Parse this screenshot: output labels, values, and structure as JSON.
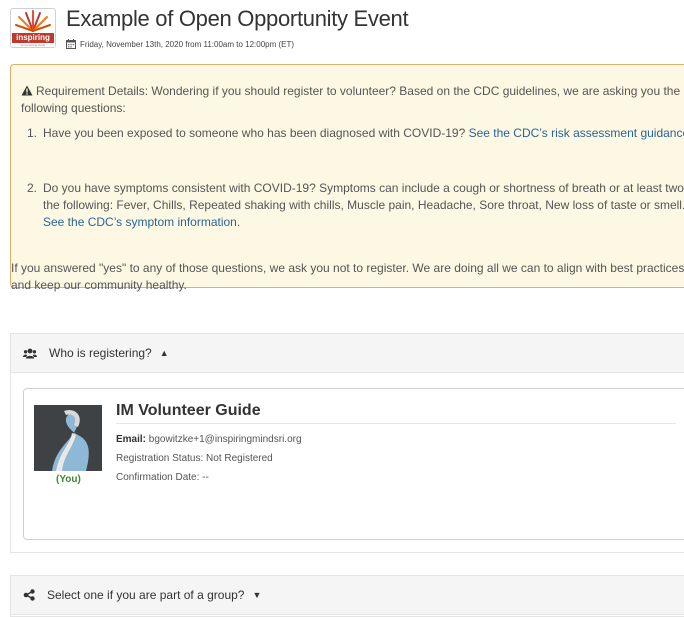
{
  "header": {
    "logo_text": "inspiring",
    "logo_subtext": "empowering study",
    "title": "Example of Open Opportunity Event",
    "date": "Friday, November 13th, 2020 from 11:00am to 12:00pm (ET)"
  },
  "requirements": {
    "intro": "Requirement Details: Wondering if you should register to volunteer? Based on the CDC guidelines, we are asking you the following questions:",
    "items": [
      {
        "number": "1.",
        "text": "Have you been exposed to someone who has been diagnosed with COVID-19? ",
        "link": "See the CDC’s risk assessment guidance."
      },
      {
        "number": "2.",
        "text": "Do you have symptoms consistent with COVID-19? Symptoms can include a cough or shortness of breath or at least two of the following: Fever, Chills, Repeated shaking with chills, Muscle pain, Headache, Sore throat, New loss of taste or smell. ",
        "link": "See the CDC’s symptom information."
      }
    ],
    "footer": "If you answered \"yes\" to any of those questions, we ask you not to register. We are doing all we can to align with best practices and keep our community healthy."
  },
  "registering": {
    "heading": "Who is registering?",
    "person": {
      "name": "IM Volunteer Guide",
      "email_label": "Email:",
      "email": "bgowitzke+1@inspiringmindsri.org",
      "status": "Registration Status: Not Registered",
      "confirmation": "Confirmation Date: --",
      "you_label": "(You)"
    }
  },
  "group": {
    "heading": "Select one if you are part of a group?"
  },
  "colors": {
    "accent_link": "#2a6496",
    "warning_bg": "#fcf8e3",
    "warning_border": "#d9b36a",
    "you_green": "#3c8c2d",
    "logo_red": "#c0392b"
  },
  "icons": [
    "calendar-icon",
    "warning-icon",
    "users-icon",
    "share-icon",
    "caret-up-icon",
    "caret-down-icon"
  ]
}
